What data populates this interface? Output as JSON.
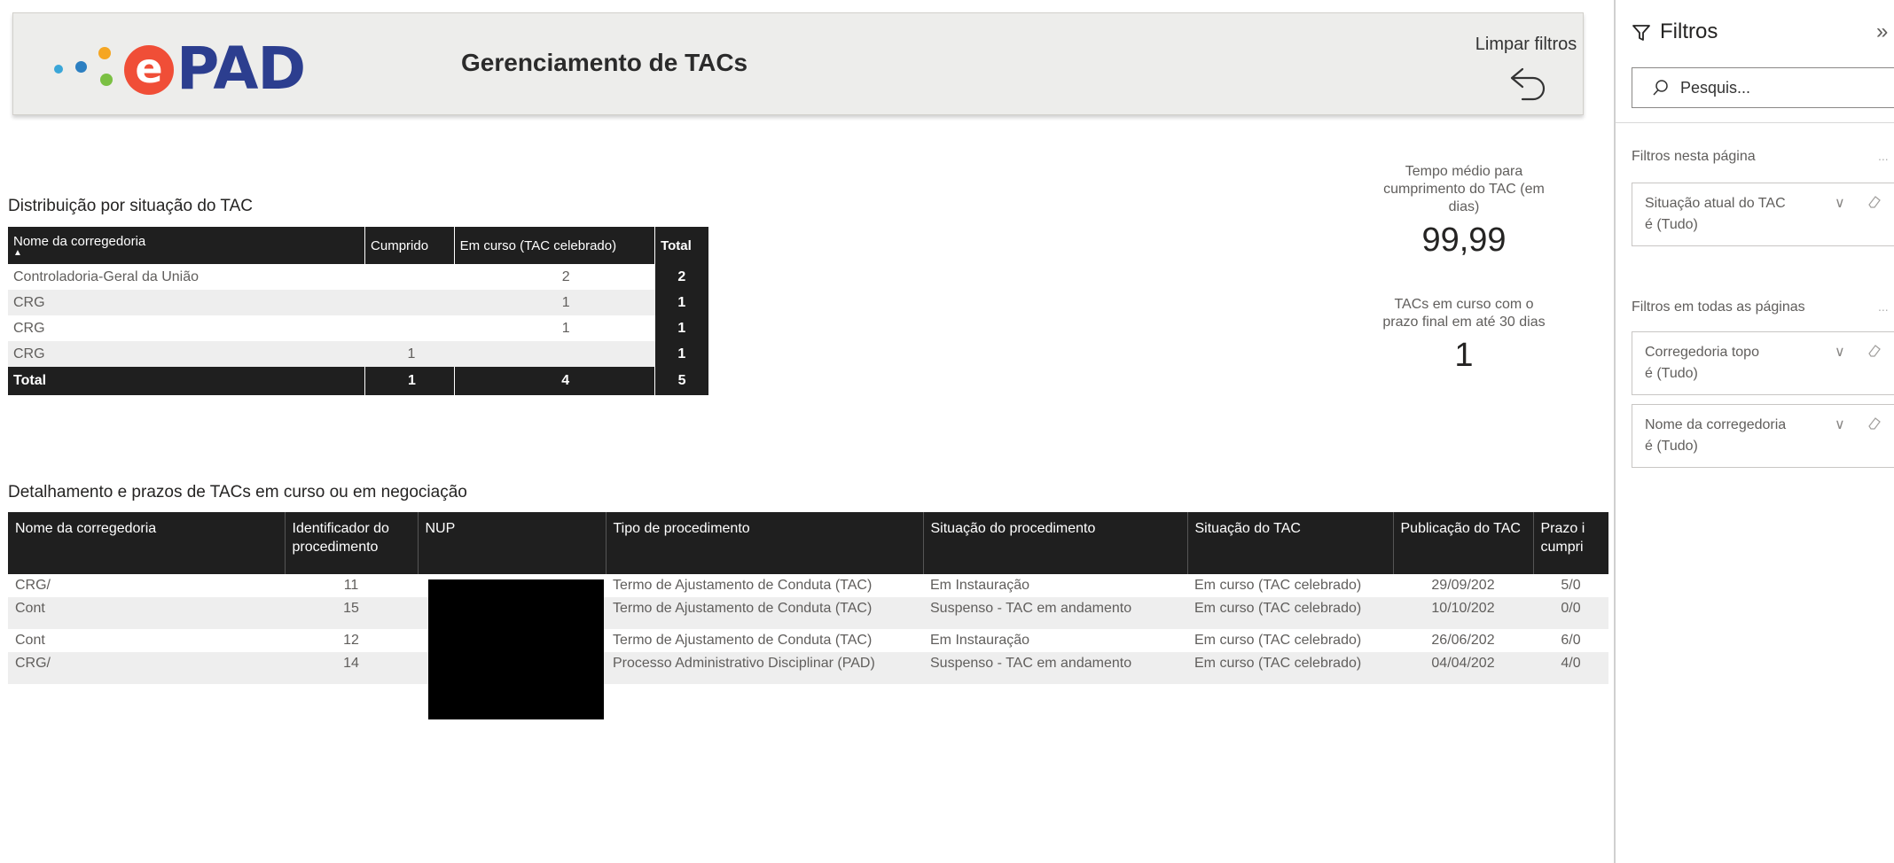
{
  "header": {
    "logo_text": "ePAD",
    "title": "Gerenciamento de TACs",
    "clear_filters_label": "Limpar filtros"
  },
  "summary": {
    "title": "Distribuição por situação do TAC",
    "columns": [
      "Nome da corregedoria",
      "Cumprido",
      "Em curso (TAC celebrado)",
      "Total"
    ],
    "rows": [
      [
        "Controladoria-Geral da União",
        "",
        "2",
        "2"
      ],
      [
        "CRG",
        "",
        "1",
        "1"
      ],
      [
        "CRG",
        "",
        "1",
        "1"
      ],
      [
        "CRG",
        "1",
        "",
        "1"
      ]
    ],
    "total_row": [
      "Total",
      "1",
      "4",
      "5"
    ]
  },
  "kpis": {
    "avg_time": {
      "label": "Tempo médio para cumprimento do TAC (em dias)",
      "value": "99,99"
    },
    "expiring": {
      "label": "TACs em curso com o prazo final em até 30 dias",
      "value": "1"
    }
  },
  "detail": {
    "title": "Detalhamento e prazos de TACs em curso ou em negociação",
    "columns": [
      "Nome da corregedoria",
      "Identificador do procedimento",
      "NUP",
      "Tipo de procedimento",
      "Situação do procedimento",
      "Situação do TAC",
      "Publicação do TAC",
      "Prazo i cumpri"
    ],
    "rows": [
      [
        "CRG/",
        "11",
        "",
        "Termo de Ajustamento de Conduta (TAC)",
        "Em Instauração",
        "Em curso (TAC celebrado)",
        "29/09/202",
        "5/0"
      ],
      [
        "Cont",
        "15",
        "",
        "Termo de Ajustamento de Conduta (TAC)",
        "Suspenso - TAC em andamento",
        "Em curso (TAC celebrado)",
        "10/10/202",
        "0/0"
      ],
      [
        "Cont",
        "12",
        "",
        "Termo de Ajustamento de Conduta (TAC)",
        "Em Instauração",
        "Em curso (TAC celebrado)",
        "26/06/202",
        "6/0"
      ],
      [
        "CRG/",
        "14",
        "",
        "Processo Administrativo Disciplinar (PAD)",
        "Suspenso - TAC em andamento",
        "Em curso (TAC celebrado)",
        "04/04/202",
        "4/0"
      ]
    ]
  },
  "filter_pane": {
    "title": "Filtros",
    "search_placeholder": "Pesquis...",
    "page_section": "Filtros nesta página",
    "all_pages_section": "Filtros em todas as páginas",
    "page_filters": [
      {
        "name": "Situação atual do TAC",
        "value": "é (Tudo)"
      }
    ],
    "all_filters": [
      {
        "name": "Corregedoria topo",
        "value": "é (Tudo)"
      },
      {
        "name": "Nome da corregedoria",
        "value": "é (Tudo)"
      }
    ]
  },
  "colors": {
    "header_bg": "#ededeb",
    "table_header_bg": "#1f1f1f",
    "logo_accent": "#f04e37",
    "logo_text": "#2c3e8f"
  }
}
